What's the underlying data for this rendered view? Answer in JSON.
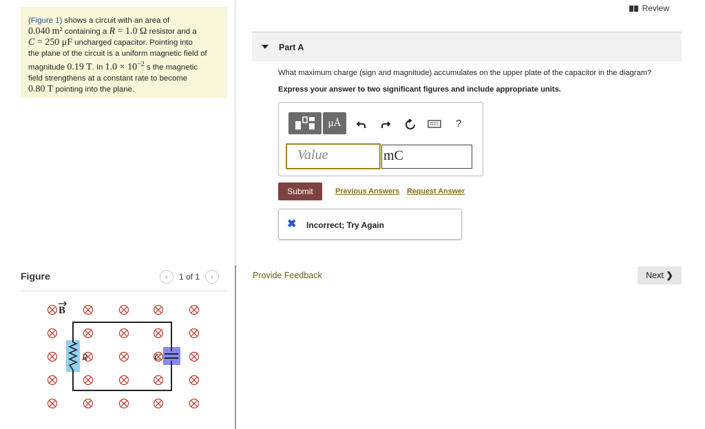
{
  "problem": {
    "fig_link": "(Figure 1)",
    "t1": " shows a circuit with an area of",
    "area": "0.040",
    "area_unit": "m²",
    "t2": " containing a ",
    "R_sym": "R",
    "R_eq": " = 1.0 Ω",
    "t3": " resistor and a",
    "C_sym": "C",
    "C_eq": " = 250 μF",
    "t4": " uncharged capacitor. Pointing into",
    "t5": "the plane of the circuit is a uniform magnetic field of",
    "t6": "magnitude ",
    "B1": "0.19 T",
    "t7": ". In ",
    "time": "1.0 × 10",
    "time_exp": "−2",
    "t8": " s the magnetic",
    "t9": "field strengthens at a constant rate to become",
    "B2": "0.80 T",
    "t10": " pointing into the plane."
  },
  "figure": {
    "title": "Figure",
    "pager": "1 of 1",
    "prev_icon": "chevron-left-icon",
    "next_icon": "chevron-right-icon",
    "B_label": "B",
    "R_label": "R",
    "C_label": "C",
    "highlight_color": "#8fd0f0",
    "cap_highlight_color": "#8888ee"
  },
  "header": {
    "review_label": "Review"
  },
  "part": {
    "label": "Part A",
    "question": "What maximum charge (sign and magnitude) accumulates on the upper plate of the capacitor in the diagram?",
    "instruction": "Express your answer to two significant figures and include appropriate units."
  },
  "answer": {
    "toolbar": {
      "templates_icon": "templates-icon",
      "units_label": "μÅ",
      "undo_icon": "undo-icon",
      "redo_icon": "redo-icon",
      "reset_icon": "reset-icon",
      "keyboard_icon": "keyboard-icon",
      "help_label": "?"
    },
    "value_placeholder": "Value",
    "unit_value": "mC"
  },
  "actions": {
    "submit_label": "Submit",
    "previous_answers": "Previous Answers",
    "request_answer": "Request Answer"
  },
  "feedback": {
    "status": "Incorrect; Try Again",
    "accent": "#2c55c8"
  },
  "footer": {
    "provide_feedback": "Provide Feedback",
    "next_label": "Next"
  }
}
